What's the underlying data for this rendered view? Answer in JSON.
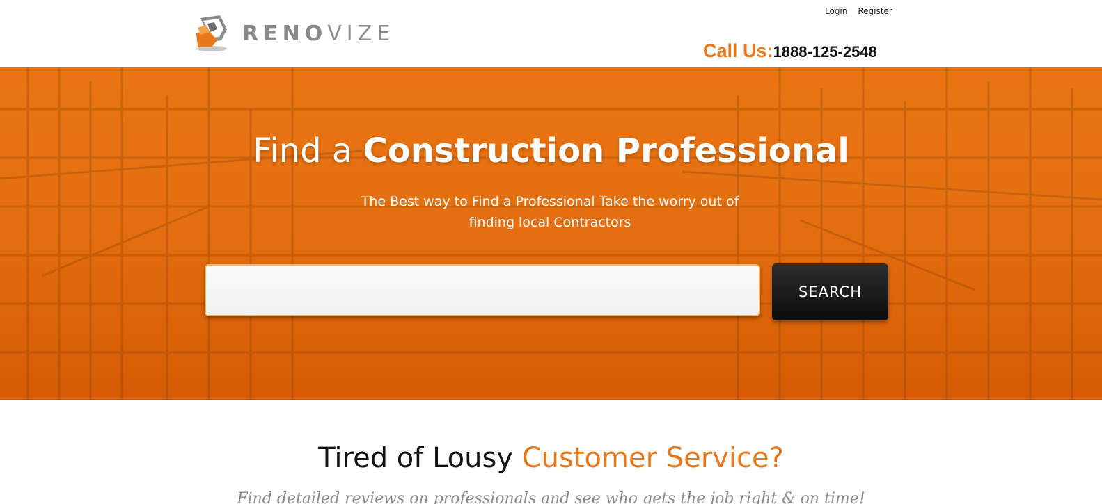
{
  "header": {
    "logo": {
      "prefix": "RENO",
      "suffix": "VIZE"
    },
    "links": {
      "login": "Login",
      "register": "Register"
    },
    "call": {
      "label": "Call Us:",
      "number": "1888-125-2548"
    }
  },
  "hero": {
    "title_light": "Find a",
    "title_bold": "Construction Professional",
    "subtitle": "The Best way to Find a Professional Take the worry out of finding local Contractors",
    "search": {
      "value": "",
      "placeholder": "",
      "button_label": "SEARCH"
    }
  },
  "section": {
    "title_plain": "Tired of Lousy",
    "title_accent": "Customer Service?",
    "subtitle": "Find detailed reviews on professionals and see who gets the job right & on time!"
  },
  "colors": {
    "accent": "#e8781c",
    "hero": "#e46f10",
    "button": "#111111"
  },
  "icons": {
    "logo": "renovize-logo-mark"
  }
}
